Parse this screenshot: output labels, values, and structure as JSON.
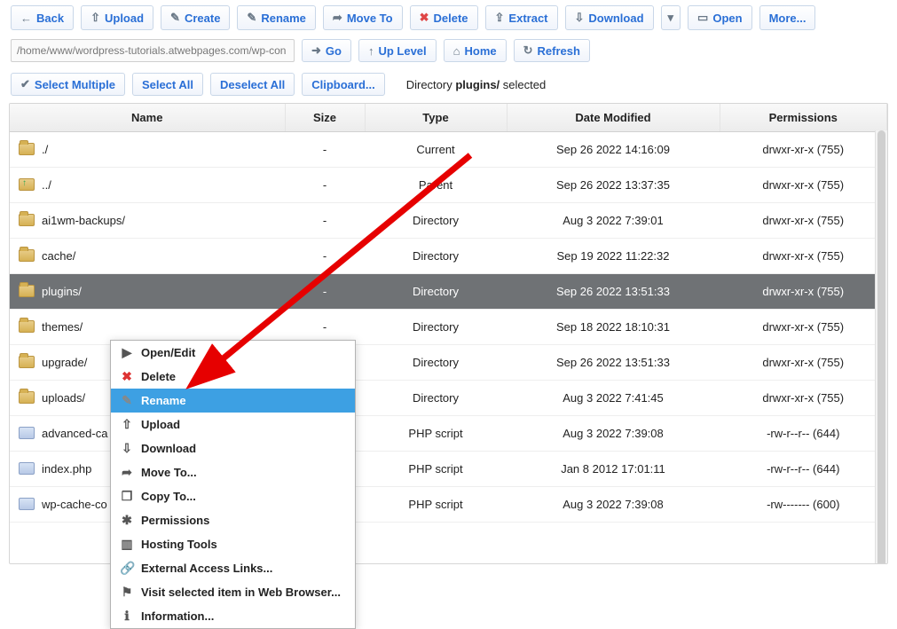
{
  "toolbar": {
    "back": "Back",
    "upload": "Upload",
    "create": "Create",
    "rename": "Rename",
    "moveto": "Move To",
    "delete": "Delete",
    "extract": "Extract",
    "download": "Download",
    "open": "Open",
    "more": "More..."
  },
  "nav": {
    "path": "/home/www/wordpress-tutorials.atwebpages.com/wp-con",
    "go": "Go",
    "uplevel": "Up Level",
    "home": "Home",
    "refresh": "Refresh"
  },
  "selectbar": {
    "selectmultiple": "Select Multiple",
    "selectall": "Select All",
    "deselectall": "Deselect All",
    "clipboard": "Clipboard..."
  },
  "status": {
    "prefix": "Directory ",
    "bold": "plugins/",
    "suffix": " selected"
  },
  "headers": {
    "name": "Name",
    "size": "Size",
    "type": "Type",
    "date": "Date Modified",
    "perm": "Permissions"
  },
  "rows": [
    {
      "icon": "folder",
      "name": "./",
      "size": "-",
      "type": "Current",
      "date": "Sep 26 2022 14:16:09",
      "perm": "drwxr-xr-x (755)",
      "selected": false
    },
    {
      "icon": "up",
      "name": "../",
      "size": "-",
      "type": "Parent",
      "date": "Sep 26 2022 13:37:35",
      "perm": "drwxr-xr-x (755)",
      "selected": false
    },
    {
      "icon": "folder",
      "name": "ai1wm-backups/",
      "size": "-",
      "type": "Directory",
      "date": "Aug 3 2022 7:39:01",
      "perm": "drwxr-xr-x (755)",
      "selected": false
    },
    {
      "icon": "folder",
      "name": "cache/",
      "size": "-",
      "type": "Directory",
      "date": "Sep 19 2022 11:22:32",
      "perm": "drwxr-xr-x (755)",
      "selected": false
    },
    {
      "icon": "folder",
      "name": "plugins/",
      "size": "-",
      "type": "Directory",
      "date": "Sep 26 2022 13:51:33",
      "perm": "drwxr-xr-x (755)",
      "selected": true
    },
    {
      "icon": "folder",
      "name": "themes/",
      "size": "-",
      "type": "Directory",
      "date": "Sep 18 2022 18:10:31",
      "perm": "drwxr-xr-x (755)",
      "selected": false
    },
    {
      "icon": "folder",
      "name": "upgrade/",
      "size": "-",
      "type": "Directory",
      "date": "Sep 26 2022 13:51:33",
      "perm": "drwxr-xr-x (755)",
      "selected": false
    },
    {
      "icon": "folder",
      "name": "uploads/",
      "size": "-",
      "type": "Directory",
      "date": "Aug 3 2022 7:41:45",
      "perm": "drwxr-xr-x (755)",
      "selected": false
    },
    {
      "icon": "php",
      "name": "advanced-ca",
      "size": "",
      "type": "PHP script",
      "date": "Aug 3 2022 7:39:08",
      "perm": "-rw-r--r-- (644)",
      "selected": false
    },
    {
      "icon": "php",
      "name": "index.php",
      "size": "",
      "type": "PHP script",
      "date": "Jan 8 2012 17:01:11",
      "perm": "-rw-r--r-- (644)",
      "selected": false
    },
    {
      "icon": "php",
      "name": "wp-cache-co",
      "size": "",
      "type": "PHP script",
      "date": "Aug 3 2022 7:39:08",
      "perm": "-rw------- (600)",
      "selected": false
    }
  ],
  "contextmenu": [
    {
      "id": "open-edit",
      "label": "Open/Edit",
      "icon": "▶",
      "highlight": false
    },
    {
      "id": "delete",
      "label": "Delete",
      "icon": "✖",
      "highlight": false,
      "red": true
    },
    {
      "id": "rename",
      "label": "Rename",
      "icon": "✎",
      "highlight": true
    },
    {
      "id": "upload",
      "label": "Upload",
      "icon": "⇧",
      "highlight": false
    },
    {
      "id": "download",
      "label": "Download",
      "icon": "⇩",
      "highlight": false
    },
    {
      "id": "moveto",
      "label": "Move To...",
      "icon": "➦",
      "highlight": false
    },
    {
      "id": "copyto",
      "label": "Copy To...",
      "icon": "❐",
      "highlight": false
    },
    {
      "id": "permissions",
      "label": "Permissions",
      "icon": "✱",
      "highlight": false
    },
    {
      "id": "hosting-tools",
      "label": "Hosting Tools",
      "icon": "▥",
      "highlight": false
    },
    {
      "id": "external-links",
      "label": "External Access Links...",
      "icon": "🔗",
      "highlight": false
    },
    {
      "id": "visit-browser",
      "label": "Visit selected item in Web Browser...",
      "icon": "⚑",
      "highlight": false
    },
    {
      "id": "information",
      "label": "Information...",
      "icon": "ℹ",
      "highlight": false
    }
  ]
}
